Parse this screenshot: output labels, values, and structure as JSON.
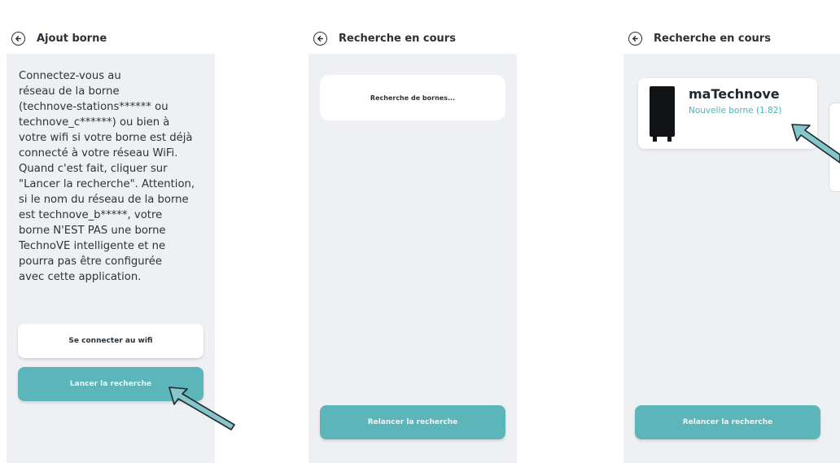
{
  "colors": {
    "accent": "#5bb5b9",
    "screen_bg": "#eef0f3",
    "text": "#2e3439"
  },
  "screens": [
    {
      "title": "Ajout borne",
      "instructions": "Connectez-vous au\nréseau de la borne\n(technove-stations****** ou\ntechnove_c******) ou bien à\nvotre wifi si votre borne est déjà\nconnecté à votre réseau WiFi.\nQuand c'est fait, cliquer sur\n\"Lancer la recherche\". Attention,\nsi le nom du réseau de la borne\nest technove_b*****, votre\nborne N'EST PAS une borne\nTechnoVE intelligente et ne\npourra pas être configurée\navec cette application.",
      "connect_button": "Se connecter au wifi",
      "search_button": "Lancer la recherche"
    },
    {
      "title": "Recherche en cours",
      "status_text": "Recherche de bornes...",
      "retry_button": "Relancer la recherche"
    },
    {
      "title": "Recherche en cours",
      "device": {
        "name": "maTechnove",
        "subtitle": "Nouvelle borne (1.82)"
      },
      "retry_button": "Relancer la recherche"
    }
  ]
}
